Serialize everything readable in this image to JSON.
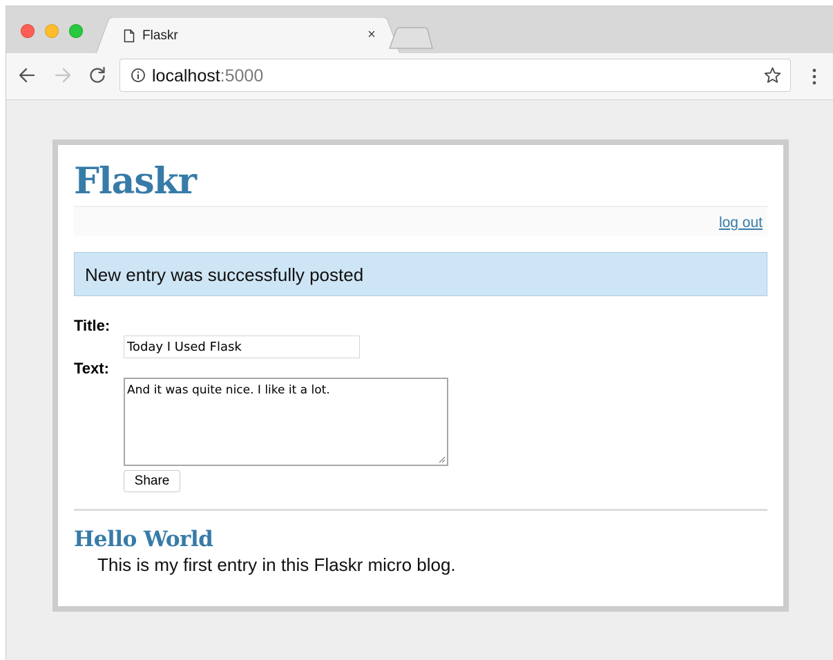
{
  "browser": {
    "tab": {
      "title": "Flaskr",
      "close_glyph": "×",
      "icon": "document-icon"
    },
    "address": {
      "host": "localhost",
      "port": ":5000",
      "icon": "info-icon"
    },
    "toolbar_icons": [
      "back-arrow-icon",
      "forward-arrow-icon",
      "reload-icon",
      "star-icon",
      "kebab-menu-icon"
    ],
    "traffic_lights": [
      "#fd5f57",
      "#febc2e",
      "#28c840"
    ]
  },
  "page": {
    "title": "Flaskr",
    "nav": {
      "logout_label": "log out"
    },
    "flash_message": "New entry was successfully posted",
    "form": {
      "title_label": "Title:",
      "title_value": "Today I Used Flask",
      "text_label": "Text:",
      "text_value": "And it was quite nice. I like it a lot.",
      "submit_label": "Share"
    },
    "entries": [
      {
        "title": "Hello World",
        "text": "This is my first entry in this Flaskr micro blog."
      }
    ]
  },
  "colors": {
    "accent": "#377ba8",
    "flash_background": "#cee5f5",
    "page_border": "#cccccc",
    "window_background": "#eeeeee"
  }
}
